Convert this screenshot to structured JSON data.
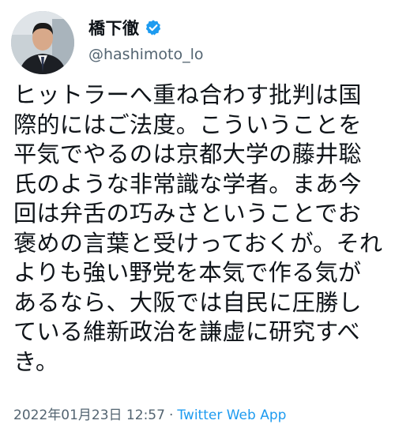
{
  "author": {
    "display_name": "橋下徹",
    "handle": "@hashimoto_lo",
    "verified_icon": "verified-badge-icon"
  },
  "tweet": {
    "text": "ヒットラーへ重ね合わす批判は国際的にはご法度。こういうことを平気でやるのは京都大学の藤井聡氏のような非常識な学者。まあ今回は弁舌の巧みさということでお褒めの言葉と受けっておくが。それよりも強い野党を本気で作る気があるなら、大阪では自民に圧勝している維新政治を謙虚に研究すべき。",
    "timestamp": "2022年01月23日 12:57",
    "separator": "·",
    "source": "Twitter Web App"
  },
  "colors": {
    "text": "#0f1419",
    "secondary": "#536471",
    "accent": "#1d9bf0"
  }
}
